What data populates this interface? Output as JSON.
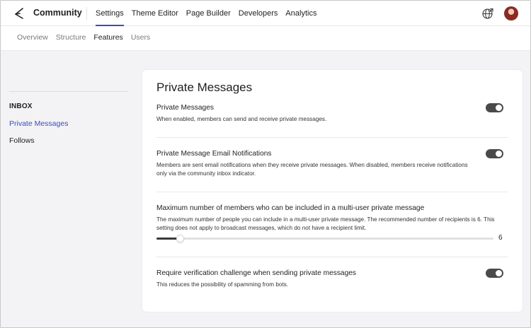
{
  "app": {
    "brand": "Community",
    "nav": [
      "Settings",
      "Theme Editor",
      "Page Builder",
      "Developers",
      "Analytics"
    ],
    "nav_active": "Settings",
    "icons": [
      "forum-logo-icon",
      "globe-icon",
      "user-avatar"
    ]
  },
  "subnav": {
    "items": [
      "Overview",
      "Structure",
      "Features",
      "Users"
    ],
    "active": "Features"
  },
  "sidebar": {
    "heading": "INBOX",
    "items": [
      {
        "label": "Private Messages",
        "active": true
      },
      {
        "label": "Follows",
        "active": false
      }
    ]
  },
  "panel": {
    "title": "Private Messages",
    "settings": [
      {
        "title": "Private Messages",
        "description": "When enabled, members can send and receive private messages.",
        "enabled": true
      },
      {
        "title": "Private Message Email Notifications",
        "description": "Members are sent email notifications when they receive private messages. When disabled, members receive notifications only via the community inbox indicator.",
        "enabled": true
      },
      {
        "title": "Maximum number of members who can be included in a multi-user private message",
        "description": "The maximum number of people you can include in a multi-user private message. The recommended number of recipients is 6. This setting does not apply to broadcast messages, which do not have a recipient limit.",
        "slider_value": "6",
        "slider_fraction": 0.07
      },
      {
        "title": "Require verification challenge when sending private messages",
        "description": "This reduces the possibility of spamming from bots.",
        "enabled": true
      }
    ]
  },
  "colors": {
    "accent": "#3b49c9",
    "toggle_on": "#4a4a4a",
    "background": "#f3f3f5"
  }
}
